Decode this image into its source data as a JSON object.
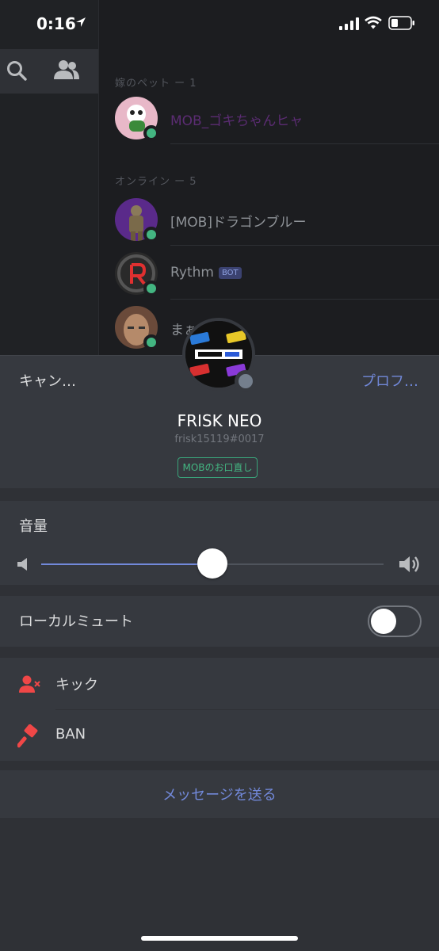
{
  "status_bar": {
    "time": "0:16"
  },
  "left_nav": {
    "icons": [
      "search-icon",
      "friends-icon"
    ]
  },
  "members": {
    "sections": [
      {
        "label": "嫁のペット ー 1"
      },
      {
        "label": "オンライン ー 5"
      }
    ],
    "rows": [
      {
        "name": "MOB_ゴキちゃんヒャ",
        "name_color": "#5b2c73",
        "status": "online"
      },
      {
        "name": "[MOB]ドラゴンブルー",
        "status": "online"
      },
      {
        "name": "Rythm",
        "tag": "BOT",
        "status": "online"
      },
      {
        "name": "まぁ",
        "status": "online"
      }
    ]
  },
  "sheet": {
    "cancel_label": "キャン…",
    "profile_label": "プロフ…",
    "username": "FRISK NEO",
    "usertag": "frisk15119#0017",
    "role": "MOBのお口直し",
    "volume": {
      "label": "音量",
      "value": 0.5
    },
    "local_mute": {
      "label": "ローカルミュート",
      "on": false
    },
    "kick_label": "キック",
    "ban_label": "BAN",
    "message_label": "メッセージを送る"
  },
  "colors": {
    "accent": "#7289da",
    "online": "#43b581",
    "danger": "#f04747",
    "offline": "#747f8d"
  }
}
